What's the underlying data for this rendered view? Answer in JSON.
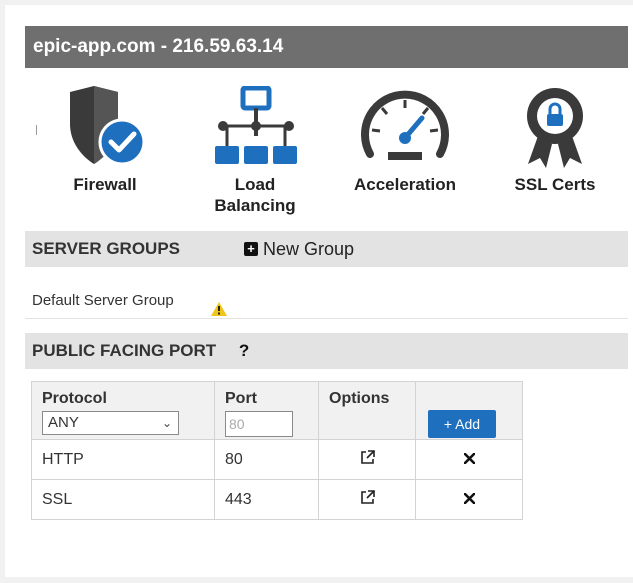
{
  "header": {
    "title": "epic-app.com - 216.59.63.14"
  },
  "features": [
    {
      "icon": "shield-check-icon",
      "label": "Firewall"
    },
    {
      "icon": "network-hierarchy-icon",
      "label_line1": "Load",
      "label_line2": "Balancing"
    },
    {
      "icon": "speedometer-icon",
      "label": "Acceleration"
    },
    {
      "icon": "certificate-lock-icon",
      "label": "SSL Certs"
    }
  ],
  "server_groups": {
    "heading": "SERVER GROUPS",
    "new_group_label": "New Group",
    "items": [
      {
        "name": "Default Server Group",
        "status_icon": "warning-icon"
      }
    ]
  },
  "public_port": {
    "heading": "PUBLIC FACING PORT",
    "help": "?",
    "columns": {
      "protocol": "Protocol",
      "port": "Port",
      "options": "Options"
    },
    "protocol_select": "ANY",
    "port_placeholder": "80",
    "add_label": "+ Add",
    "rows": [
      {
        "protocol": "HTTP",
        "port": "80"
      },
      {
        "protocol": "SSL",
        "port": "443"
      }
    ]
  },
  "colors": {
    "title_bar": "#6f6f6f",
    "section_bar": "#e3e3e3",
    "accent_blue": "#1f6fbf",
    "icon_blue": "#1f6fbf",
    "icon_dark": "#3a3a3a"
  }
}
